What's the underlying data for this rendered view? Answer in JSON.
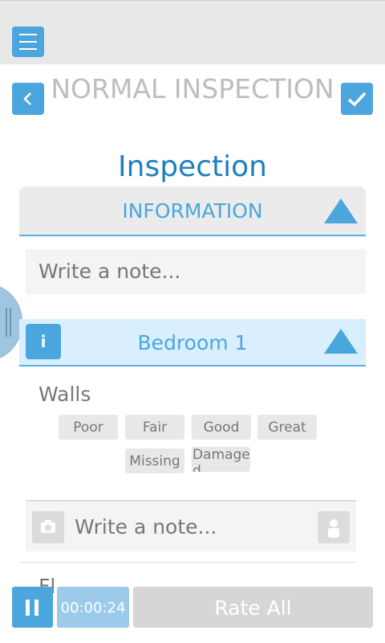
{
  "header": {
    "title": "NORMAL INSPECTION",
    "subtitle": "Inspection"
  },
  "information_section": {
    "label": "INFORMATION",
    "note_placeholder": "Write a note..."
  },
  "room_section": {
    "label": "Bedroom 1",
    "info_icon_label": "i"
  },
  "item": {
    "name": "Walls",
    "rating_options": [
      "Poor",
      "Fair",
      "Good",
      "Great",
      "Missing",
      "Damaged"
    ],
    "note_placeholder": "Write a note..."
  },
  "next_item_partial": "Fl",
  "footer": {
    "timer": "00:00:24",
    "rate_all_label": "Rate All"
  },
  "colors": {
    "accent": "#4aa6dd",
    "title_gray": "#bdbdbd",
    "subtitle_blue": "#1f7fc0",
    "room_header_bg": "#d9efff"
  },
  "icons": [
    "hamburger-menu-icon",
    "chevron-left-icon",
    "checkmark-icon",
    "collapse-triangle-icon",
    "info-icon",
    "camera-icon",
    "user-icon",
    "pause-icon"
  ]
}
